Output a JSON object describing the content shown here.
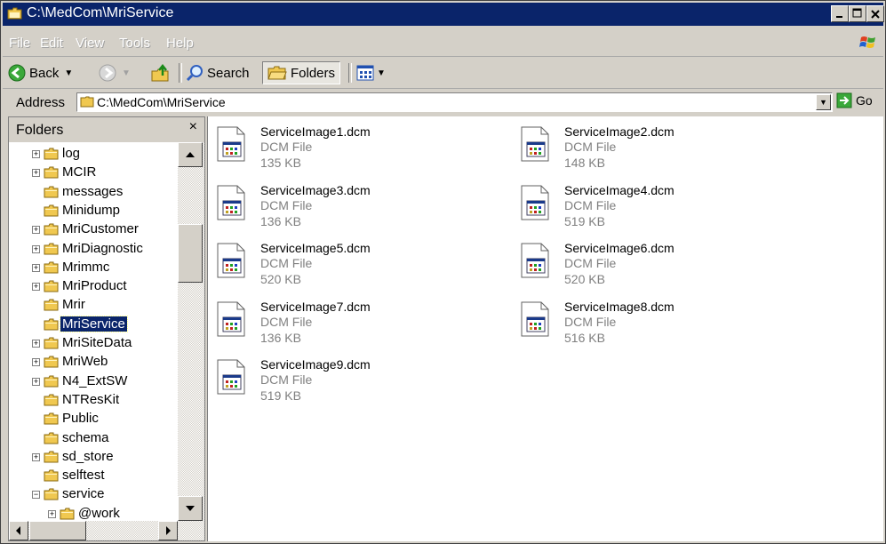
{
  "window": {
    "title": "C:\\MedCom\\MriService",
    "title_bg": "#0a246a"
  },
  "menu": [
    "File",
    "Edit",
    "View",
    "Tools",
    "Help"
  ],
  "toolbar": {
    "back_label": "Back",
    "search_label": "Search",
    "folders_label": "Folders"
  },
  "address": {
    "label": "Address",
    "value": "C:\\MedCom\\MriService",
    "go_label": "Go"
  },
  "folders_pane": {
    "title": "Folders",
    "close_glyph": "×",
    "tree": [
      {
        "label": "log",
        "expander": "+",
        "indent": 1
      },
      {
        "label": "MCIR",
        "expander": "+",
        "indent": 1
      },
      {
        "label": "messages",
        "expander": "",
        "indent": 1
      },
      {
        "label": "Minidump",
        "expander": "",
        "indent": 1
      },
      {
        "label": "MriCustomer",
        "expander": "+",
        "indent": 1
      },
      {
        "label": "MriDiagnostic",
        "expander": "+",
        "indent": 1
      },
      {
        "label": "Mrimmc",
        "expander": "+",
        "indent": 1
      },
      {
        "label": "MriProduct",
        "expander": "+",
        "indent": 1
      },
      {
        "label": "Mrir",
        "expander": "",
        "indent": 1
      },
      {
        "label": "MriService",
        "expander": "",
        "indent": 1,
        "selected": true
      },
      {
        "label": "MriSiteData",
        "expander": "+",
        "indent": 1
      },
      {
        "label": "MriWeb",
        "expander": "+",
        "indent": 1
      },
      {
        "label": "N4_ExtSW",
        "expander": "+",
        "indent": 1
      },
      {
        "label": "NTResKit",
        "expander": "",
        "indent": 1
      },
      {
        "label": "Public",
        "expander": "",
        "indent": 1
      },
      {
        "label": "schema",
        "expander": "",
        "indent": 1
      },
      {
        "label": "sd_store",
        "expander": "+",
        "indent": 1
      },
      {
        "label": "selftest",
        "expander": "",
        "indent": 1
      },
      {
        "label": "service",
        "expander": "−",
        "indent": 1
      },
      {
        "label": "@work",
        "expander": "+",
        "indent": 2
      }
    ]
  },
  "files": [
    {
      "name": "ServiceImage1.dcm",
      "type": "DCM File",
      "size": "135 KB"
    },
    {
      "name": "ServiceImage2.dcm",
      "type": "DCM File",
      "size": "148 KB"
    },
    {
      "name": "ServiceImage3.dcm",
      "type": "DCM File",
      "size": "136 KB"
    },
    {
      "name": "ServiceImage4.dcm",
      "type": "DCM File",
      "size": "519 KB"
    },
    {
      "name": "ServiceImage5.dcm",
      "type": "DCM File",
      "size": "520 KB"
    },
    {
      "name": "ServiceImage6.dcm",
      "type": "DCM File",
      "size": "520 KB"
    },
    {
      "name": "ServiceImage7.dcm",
      "type": "DCM File",
      "size": "136 KB"
    },
    {
      "name": "ServiceImage8.dcm",
      "type": "DCM File",
      "size": "516 KB"
    },
    {
      "name": "ServiceImage9.dcm",
      "type": "DCM File",
      "size": "519 KB"
    }
  ]
}
